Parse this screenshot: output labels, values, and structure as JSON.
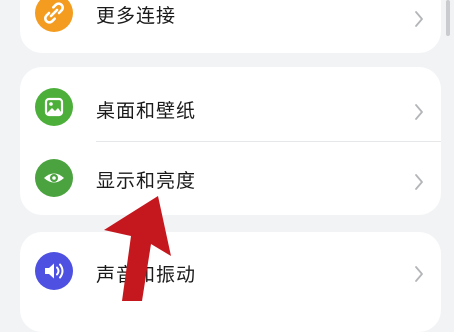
{
  "items": [
    {
      "label": "更多连接",
      "icon": "link-icon",
      "color": "#f39c1f"
    },
    {
      "label": "桌面和壁纸",
      "icon": "image-icon",
      "color": "#4caf3a"
    },
    {
      "label": "显示和亮度",
      "icon": "eye-icon",
      "color": "#4aa33e"
    },
    {
      "label": "声音和振动",
      "icon": "speaker-icon",
      "color": "#4d50e0"
    }
  ],
  "annotation": {
    "color": "#c4181e"
  }
}
